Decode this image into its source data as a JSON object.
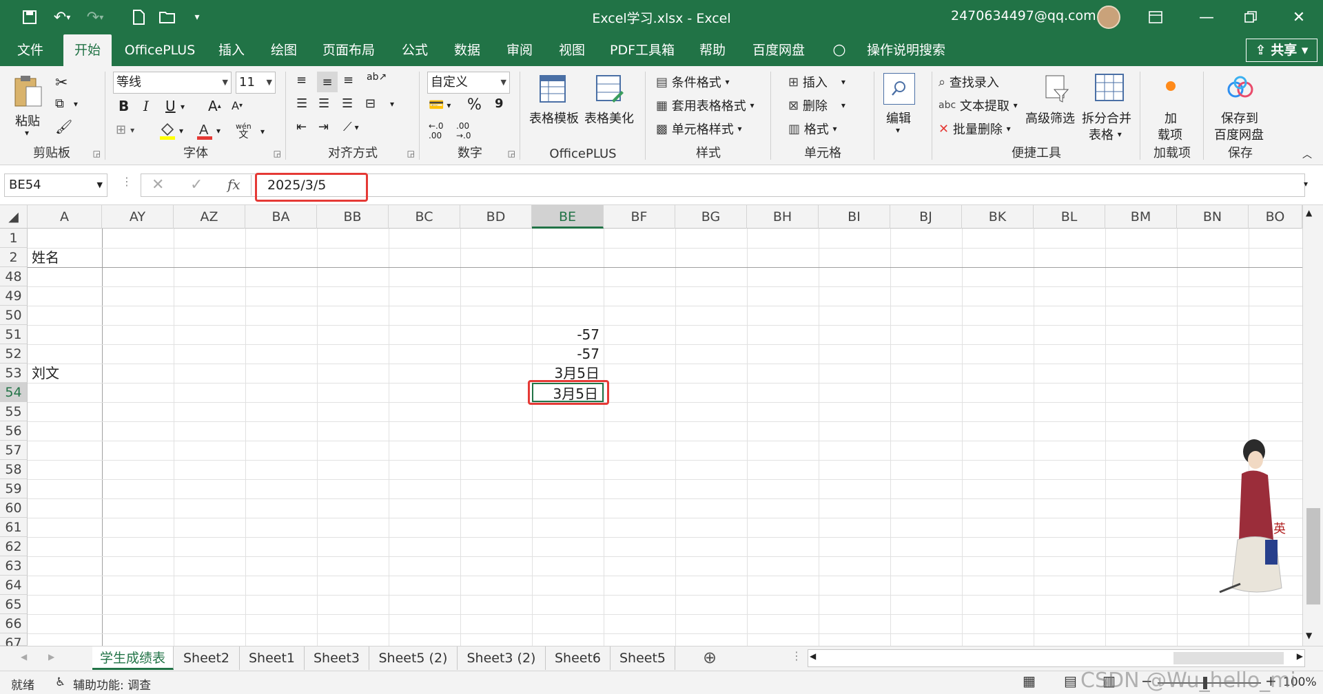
{
  "window": {
    "title": "Excel学习.xlsx  -  Excel",
    "account": "2470634497@qq.com"
  },
  "tabs": [
    "文件",
    "开始",
    "OfficePLUS",
    "插入",
    "绘图",
    "页面布局",
    "公式",
    "数据",
    "审阅",
    "视图",
    "PDF工具箱",
    "帮助",
    "百度网盘",
    "操作说明搜索"
  ],
  "share_label": "共享",
  "ribbon": {
    "clipboard": {
      "paste": "粘贴",
      "label": "剪贴板"
    },
    "font": {
      "name": "等线",
      "size": "11",
      "bold": "B",
      "italic": "I",
      "underline": "U",
      "label": "字体",
      "phonetic_top": "wén",
      "phonetic_bottom": "文"
    },
    "alignment": {
      "label": "对齐方式"
    },
    "number": {
      "format": "自定义",
      "percent": "%",
      "comma": "9",
      "label": "数字"
    },
    "officeplus": {
      "template": "表格模板",
      "beautify": "表格美化",
      "label": "OfficePLUS"
    },
    "styles": {
      "conditional": "条件格式",
      "table_format": "套用表格格式",
      "cell_style": "单元格样式",
      "label": "样式"
    },
    "cells": {
      "insert": "插入",
      "delete": "删除",
      "format": "格式",
      "label": "单元格"
    },
    "edit": {
      "label": "编辑"
    },
    "tools": {
      "find": "查找录入",
      "extract": "文本提取",
      "batch_delete": "批量删除",
      "adv_filter": "高级筛选",
      "split_merge_1": "拆分合并",
      "split_merge_2": "表格",
      "label": "便捷工具"
    },
    "addins": {
      "btn_1": "加",
      "btn_2": "载项",
      "label": "加载项"
    },
    "save": {
      "btn_1": "保存到",
      "btn_2": "百度网盘",
      "label": "保存"
    }
  },
  "formula_bar": {
    "name_box": "BE54",
    "value": "2025/3/5",
    "fx": "fx"
  },
  "grid": {
    "columns": [
      "A",
      "AY",
      "AZ",
      "BA",
      "BB",
      "BC",
      "BD",
      "BE",
      "BF",
      "BG",
      "BH",
      "BI",
      "BJ",
      "BK",
      "BL",
      "BM",
      "BN",
      "BO"
    ],
    "selected_column": "BE",
    "rows": [
      "1",
      "2",
      "48",
      "49",
      "50",
      "51",
      "52",
      "53",
      "54",
      "55",
      "56",
      "57",
      "58",
      "59",
      "60",
      "61",
      "62",
      "63",
      "64",
      "65",
      "66",
      "67"
    ],
    "selected_row": "54",
    "cells": {
      "A2": "姓名",
      "A53": "刘文",
      "BE51": "-57",
      "BE52": "-57",
      "BE53": "3月5日",
      "BE54": "3月5日"
    }
  },
  "sheets": [
    "学生成绩表",
    "Sheet2",
    "Sheet1",
    "Sheet3",
    "Sheet5 (2)",
    "Sheet3 (2)",
    "Sheet6",
    "Sheet5"
  ],
  "active_sheet": "学生成绩表",
  "status": {
    "ready": "就绪",
    "accessibility": "辅助功能: 调查",
    "zoom": "100%"
  },
  "watermark": "CSDN @Wu_hello_mi",
  "colors": {
    "excel_green": "#217346",
    "highlight_red": "#e53935"
  }
}
